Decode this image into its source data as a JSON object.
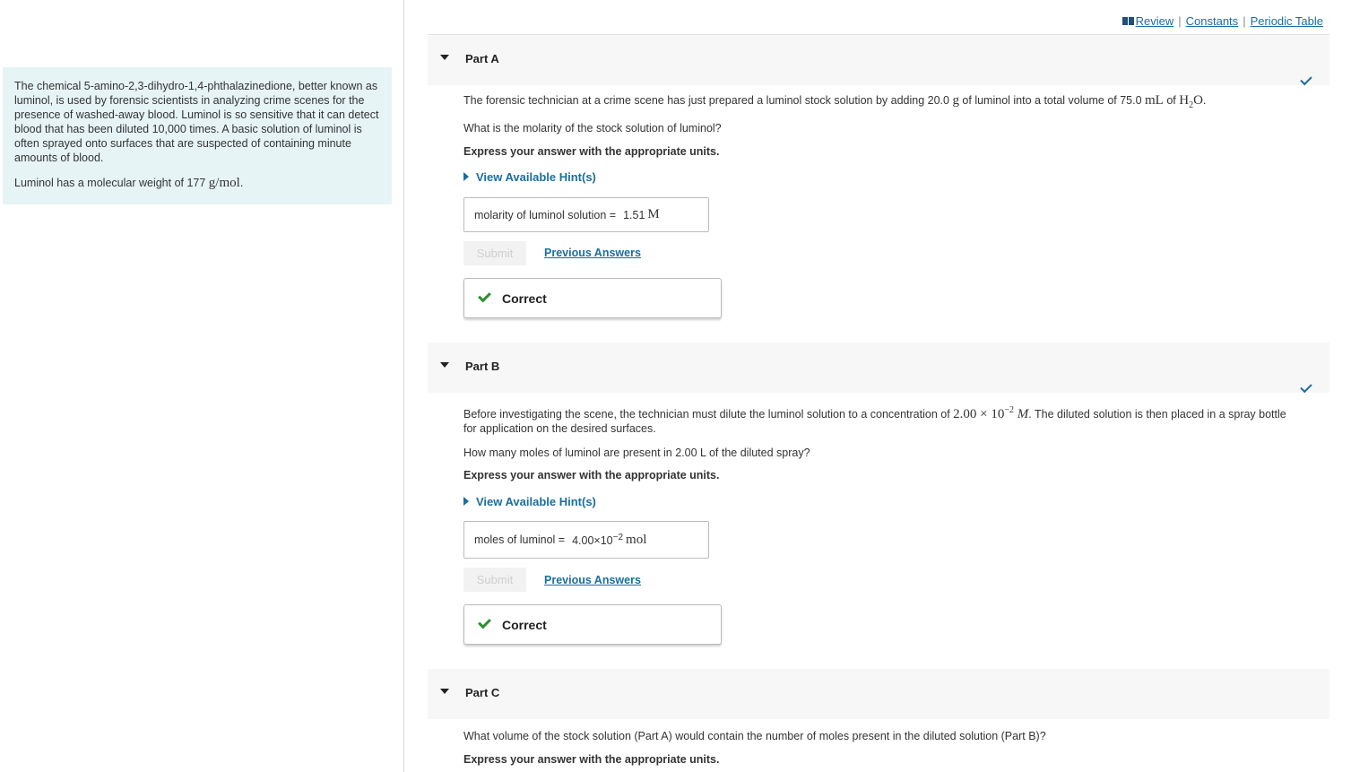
{
  "intro": {
    "paragraph": "The chemical 5-amino-2,3-dihydro-1,4-phthalazinedione, better known as luminol, is used by forensic scientists in analyzing crime scenes for the presence of washed-away blood. Luminol is so sensitive that it can detect blood that has been diluted 10,000 times. A basic solution of luminol is often sprayed onto surfaces that are suspected of containing minute amounts of blood.",
    "mw_prefix": "Luminol has a molecular weight of 177 ",
    "mw_unit": "g/mol",
    "mw_suffix": "."
  },
  "toplinks": {
    "review": "Review",
    "constants": "Constants",
    "periodic_table": "Periodic Table",
    "separator": "|"
  },
  "colors": {
    "accent": "#1a6e9e",
    "correct_green": "#2f8f2f",
    "intro_bg": "#e6f4f6"
  },
  "part_a": {
    "title": "Part A",
    "statement_prefix": "The forensic technician at a crime scene has just prepared a luminol stock solution by adding 20.0 ",
    "statement_g": "g",
    "statement_mid": " of luminol into a total volume of 75.0 ",
    "statement_ml": "mL",
    "statement_of": " of ",
    "statement_h2o_h": "H",
    "statement_h2o_2": "2",
    "statement_h2o_o": "O",
    "statement_end": ".",
    "question": "What is the molarity of the stock solution of luminol?",
    "instruction": "Express your answer with the appropriate units.",
    "hint": "View Available Hint(s)",
    "answer_label": "molarity of luminol solution =",
    "answer_value": "1.51",
    "answer_unit": "M",
    "submit": "Submit",
    "previous": "Previous Answers",
    "feedback": "Correct"
  },
  "part_b": {
    "title": "Part B",
    "statement_prefix": "Before investigating the scene, the technician must dilute the luminol solution to a concentration of ",
    "conc_base": "2.00 × 10",
    "conc_exp": "−2",
    "conc_unit": " M",
    "statement_suffix": ". The diluted solution is then placed in a spray bottle",
    "statement_line2": "for application on the desired surfaces.",
    "question": "How many moles of luminol are present in 2.00 L of the diluted spray?",
    "instruction": "Express your answer with the appropriate units.",
    "hint": "View Available Hint(s)",
    "answer_label": "moles of luminol =",
    "answer_base": "4.00×10",
    "answer_exp": "−2",
    "answer_unit": "mol",
    "submit": "Submit",
    "previous": "Previous Answers",
    "feedback": "Correct"
  },
  "part_c": {
    "title": "Part C",
    "question": "What volume of the stock solution (Part A) would contain the number of moles present in the diluted solution (Part B)?",
    "instruction": "Express your answer with the appropriate units."
  }
}
